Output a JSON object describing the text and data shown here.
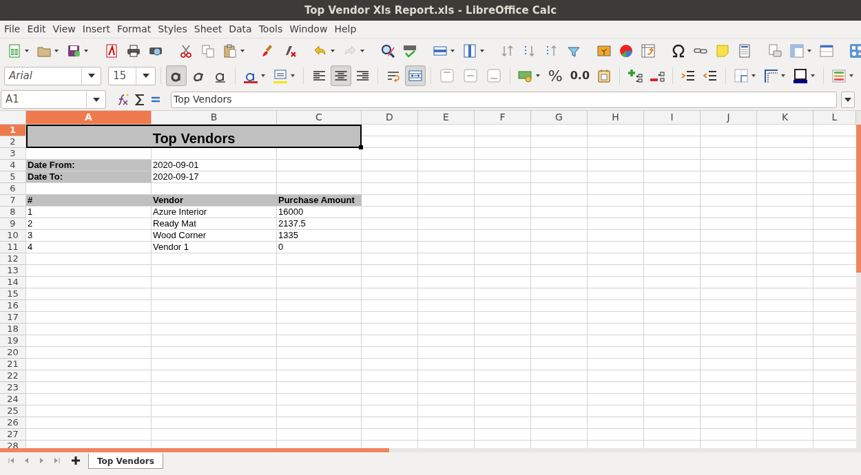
{
  "window": {
    "title": "Top Vendor Xls Report.xls - LibreOffice Calc"
  },
  "menu": [
    "File",
    "Edit",
    "View",
    "Insert",
    "Format",
    "Styles",
    "Sheet",
    "Data",
    "Tools",
    "Window",
    "Help"
  ],
  "formatting": {
    "font_name": "Arial",
    "font_size": "15",
    "bold": true,
    "italic": false,
    "underline": false,
    "align_left": false,
    "align_center": true,
    "align_right": false,
    "wrap_text": false,
    "merge_center": true,
    "percent_label": "%",
    "decimal_label": "0.0"
  },
  "formula_bar": {
    "name_box": "A1",
    "content": "Top Vendors"
  },
  "sheet": {
    "columns": [
      {
        "label": "A",
        "selected": true
      },
      {
        "label": "B",
        "selected": false
      },
      {
        "label": "C",
        "selected": false
      },
      {
        "label": "D",
        "selected": false
      },
      {
        "label": "E",
        "selected": false
      },
      {
        "label": "F",
        "selected": false
      },
      {
        "label": "G",
        "selected": false
      },
      {
        "label": "H",
        "selected": false
      },
      {
        "label": "I",
        "selected": false
      },
      {
        "label": "J",
        "selected": false
      },
      {
        "label": "K",
        "selected": false
      },
      {
        "label": "L",
        "selected": false
      }
    ],
    "title_cell": {
      "text": "Top Vendors",
      "selected": true
    },
    "rows": [
      {
        "label": "1",
        "selected": true
      },
      {
        "label": "2",
        "selected": false
      },
      {
        "label": "3",
        "selected": false
      },
      {
        "label": "4",
        "selected": false,
        "cells": [
          {
            "text": "Date From:",
            "kind": "label"
          },
          {
            "text": "2020-09-01",
            "kind": "value"
          }
        ]
      },
      {
        "label": "5",
        "selected": false,
        "cells": [
          {
            "text": "Date To:",
            "kind": "label"
          },
          {
            "text": "2020-09-17",
            "kind": "value"
          }
        ]
      },
      {
        "label": "6",
        "selected": false
      },
      {
        "label": "7",
        "selected": false,
        "cells": [
          {
            "text": "#",
            "kind": "label"
          },
          {
            "text": "Vendor",
            "kind": "label"
          },
          {
            "text": "Purchase Amount",
            "kind": "label"
          }
        ]
      },
      {
        "label": "8",
        "selected": false,
        "cells": [
          {
            "text": "1",
            "kind": "value"
          },
          {
            "text": "Azure Interior",
            "kind": "value"
          },
          {
            "text": "16000",
            "kind": "value"
          }
        ]
      },
      {
        "label": "9",
        "selected": false,
        "cells": [
          {
            "text": "2",
            "kind": "value"
          },
          {
            "text": "Ready Mat",
            "kind": "value"
          },
          {
            "text": "2137.5",
            "kind": "value"
          }
        ]
      },
      {
        "label": "10",
        "selected": false,
        "cells": [
          {
            "text": "3",
            "kind": "value"
          },
          {
            "text": "Wood Corner",
            "kind": "value"
          },
          {
            "text": "1335",
            "kind": "value"
          }
        ]
      },
      {
        "label": "11",
        "selected": false,
        "cells": [
          {
            "text": "4",
            "kind": "value"
          },
          {
            "text": "Vendor 1",
            "kind": "value"
          },
          {
            "text": "0",
            "kind": "value"
          }
        ]
      },
      {
        "label": "12",
        "selected": false
      },
      {
        "label": "13",
        "selected": false
      },
      {
        "label": "14",
        "selected": false
      },
      {
        "label": "15",
        "selected": false
      },
      {
        "label": "16",
        "selected": false
      },
      {
        "label": "17",
        "selected": false
      },
      {
        "label": "18",
        "selected": false
      },
      {
        "label": "19",
        "selected": false
      },
      {
        "label": "20",
        "selected": false
      },
      {
        "label": "21",
        "selected": false
      },
      {
        "label": "22",
        "selected": false
      },
      {
        "label": "23",
        "selected": false
      },
      {
        "label": "24",
        "selected": false
      },
      {
        "label": "25",
        "selected": false
      },
      {
        "label": "26",
        "selected": false
      },
      {
        "label": "27",
        "selected": false
      },
      {
        "label": "28",
        "selected": false
      }
    ]
  },
  "sheet_tabs": [
    {
      "label": "Top Vendors",
      "selected": true
    }
  ]
}
